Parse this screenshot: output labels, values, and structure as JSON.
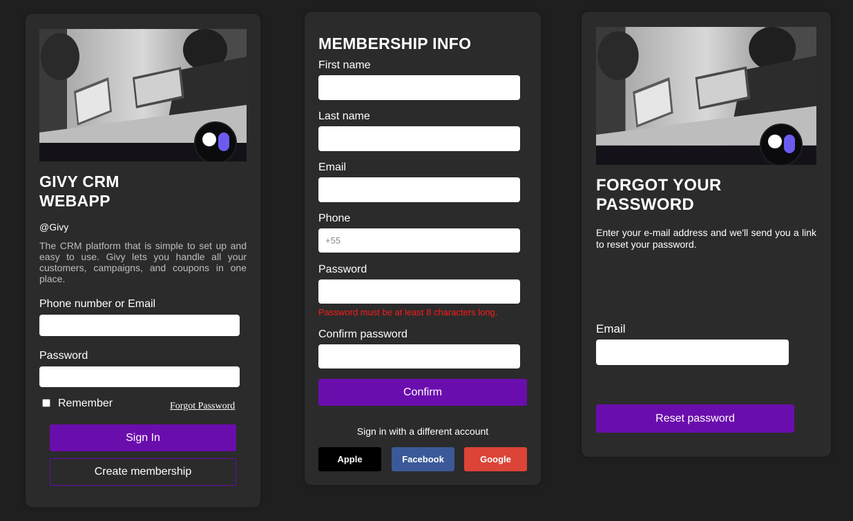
{
  "login": {
    "title_line1": "GIVY CRM",
    "title_line2": "WEBAPP",
    "handle": "@Givy",
    "description": "The CRM platform that is simple to set up and easy to use. Givy lets you handle all your customers, campaigns, and coupons in one place.",
    "identifier_label": "Phone number or Email",
    "password_label": "Password",
    "remember_label": "Remember",
    "forgot_link": "Forgot Password",
    "sign_in_button": "Sign In",
    "create_button": "Create membership"
  },
  "membership": {
    "title": "MEMBERSHIP INFO",
    "first_name_label": "First name",
    "last_name_label": "Last name",
    "email_label": "Email",
    "phone_label": "Phone",
    "phone_placeholder": "+55",
    "password_label": "Password",
    "password_error": "Password must be at least 8 characters long.",
    "confirm_password_label": "Confirm password",
    "confirm_button": "Confirm",
    "alt_signin_text": "Sign in with a different account",
    "social": [
      {
        "label": "Apple",
        "color": "#000000"
      },
      {
        "label": "Facebook",
        "color": "#3b5998"
      },
      {
        "label": "Google",
        "color": "#db4437"
      }
    ]
  },
  "forgot": {
    "title_line1": "FORGOT YOUR",
    "title_line2": "PASSWORD",
    "description": "Enter your e-mail address and we'll send you a link to reset your password.",
    "email_label": "Email",
    "reset_button": "Reset password"
  },
  "colors": {
    "accent": "#6a0dad",
    "error": "#ff1a1a",
    "card": "#2b2b2b",
    "background": "#1f1f1f"
  }
}
